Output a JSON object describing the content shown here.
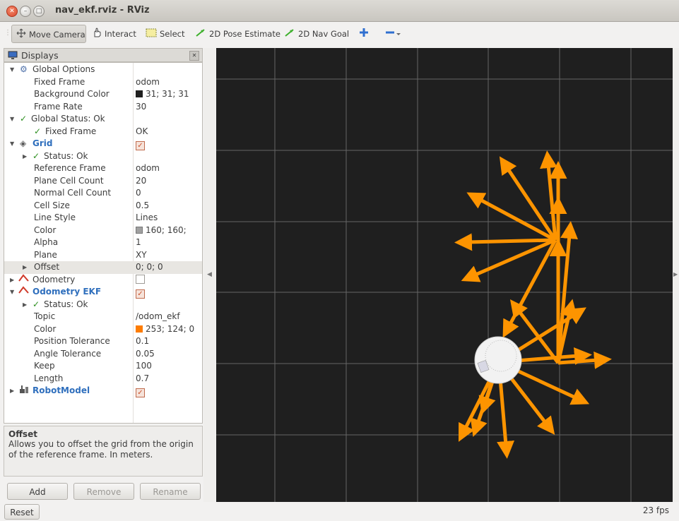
{
  "window": {
    "title": "nav_ekf.rviz - RViz"
  },
  "toolbar": {
    "tools": [
      {
        "label": "Move Camera",
        "icon": "move-camera-icon"
      },
      {
        "label": "Interact",
        "icon": "hand-icon"
      },
      {
        "label": "Select",
        "icon": "select-icon"
      },
      {
        "label": "2D Pose Estimate",
        "icon": "green-arrow-icon"
      },
      {
        "label": "2D Nav Goal",
        "icon": "green-arrow-icon"
      }
    ]
  },
  "displays": {
    "title": "Displays",
    "rows": [
      {
        "label": "Global Options",
        "value": ""
      },
      {
        "label": "Fixed Frame",
        "value": "odom"
      },
      {
        "label": "Background Color",
        "value": "31; 31; 31"
      },
      {
        "label": "Frame Rate",
        "value": "30"
      },
      {
        "label": "Global Status: Ok",
        "value": ""
      },
      {
        "label": "Fixed Frame",
        "value": "OK"
      },
      {
        "label": "Grid",
        "value": ""
      },
      {
        "label": "Status: Ok",
        "value": ""
      },
      {
        "label": "Reference Frame",
        "value": "odom"
      },
      {
        "label": "Plane Cell Count",
        "value": "20"
      },
      {
        "label": "Normal Cell Count",
        "value": "0"
      },
      {
        "label": "Cell Size",
        "value": "0.5"
      },
      {
        "label": "Line Style",
        "value": "Lines"
      },
      {
        "label": "Color",
        "value": "160; 160;"
      },
      {
        "label": "Alpha",
        "value": "1"
      },
      {
        "label": "Plane",
        "value": "XY"
      },
      {
        "label": "Offset",
        "value": "0; 0; 0"
      },
      {
        "label": "Odometry",
        "value": ""
      },
      {
        "label": "Odometry EKF",
        "value": ""
      },
      {
        "label": "Status: Ok",
        "value": ""
      },
      {
        "label": "Topic",
        "value": "/odom_ekf"
      },
      {
        "label": "Color",
        "value": "253; 124; 0"
      },
      {
        "label": "Position Tolerance",
        "value": "0.1"
      },
      {
        "label": "Angle Tolerance",
        "value": "0.05"
      },
      {
        "label": "Keep",
        "value": "100"
      },
      {
        "label": "Length",
        "value": "0.7"
      },
      {
        "label": "RobotModel",
        "value": ""
      }
    ]
  },
  "colors": {
    "background": "#1f1f1f",
    "grid": "#a0a0a0",
    "odometry": "#fd7c00",
    "bgswatch": "#1f1f1f",
    "gridswatch": "#a0a0a0",
    "odomswatch": "#fd7c00"
  },
  "help": {
    "title": "Offset",
    "text": "Allows you to offset the grid from the origin of the reference frame. In meters."
  },
  "buttons": {
    "add": "Add",
    "remove": "Remove",
    "rename": "Rename",
    "reset": "Reset"
  },
  "status": {
    "fps": "23 fps"
  }
}
